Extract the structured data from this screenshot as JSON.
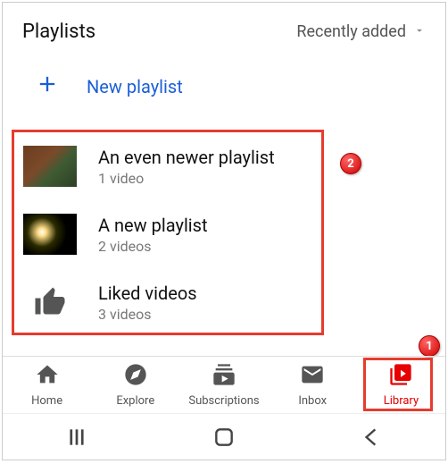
{
  "header": {
    "title": "Playlists",
    "sort_label": "Recently added"
  },
  "new_playlist_label": "New playlist",
  "playlists": [
    {
      "title": "An even newer playlist",
      "count": "1 video"
    },
    {
      "title": "A new playlist",
      "count": "2 videos"
    },
    {
      "title": "Liked videos",
      "count": "3 videos"
    }
  ],
  "nav": {
    "home": "Home",
    "explore": "Explore",
    "subscriptions": "Subscriptions",
    "inbox": "Inbox",
    "library": "Library"
  },
  "annotations": {
    "badge1": "1",
    "badge2": "2"
  }
}
